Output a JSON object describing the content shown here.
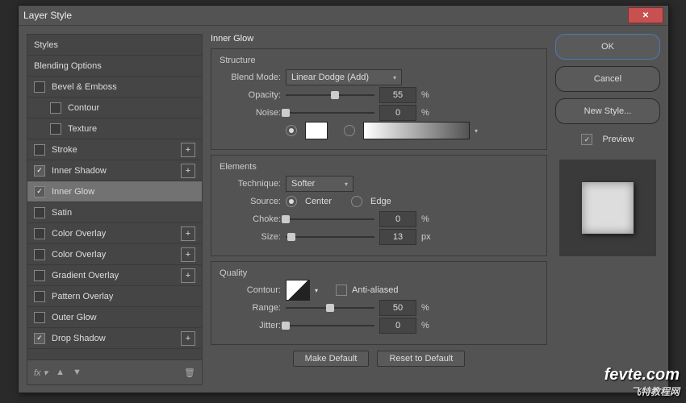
{
  "title": "Layer Style",
  "styles": {
    "header1": "Styles",
    "header2": "Blending Options",
    "items": [
      {
        "label": "Bevel & Emboss",
        "checked": false,
        "plus": false,
        "indent": false
      },
      {
        "label": "Contour",
        "checked": false,
        "plus": false,
        "indent": true
      },
      {
        "label": "Texture",
        "checked": false,
        "plus": false,
        "indent": true
      },
      {
        "label": "Stroke",
        "checked": false,
        "plus": true,
        "indent": false
      },
      {
        "label": "Inner Shadow",
        "checked": true,
        "plus": true,
        "indent": false
      },
      {
        "label": "Inner Glow",
        "checked": true,
        "plus": false,
        "indent": false,
        "selected": true
      },
      {
        "label": "Satin",
        "checked": false,
        "plus": false,
        "indent": false
      },
      {
        "label": "Color Overlay",
        "checked": false,
        "plus": true,
        "indent": false
      },
      {
        "label": "Color Overlay",
        "checked": false,
        "plus": true,
        "indent": false
      },
      {
        "label": "Gradient Overlay",
        "checked": false,
        "plus": true,
        "indent": false
      },
      {
        "label": "Pattern Overlay",
        "checked": false,
        "plus": false,
        "indent": false
      },
      {
        "label": "Outer Glow",
        "checked": false,
        "plus": false,
        "indent": false
      },
      {
        "label": "Drop Shadow",
        "checked": true,
        "plus": true,
        "indent": false
      }
    ]
  },
  "panel": {
    "title": "Inner Glow",
    "structure_label": "Structure",
    "blend_mode_label": "Blend Mode:",
    "blend_mode_value": "Linear Dodge (Add)",
    "opacity_label": "Opacity:",
    "opacity_value": "55",
    "noise_label": "Noise:",
    "noise_value": "0",
    "percent": "%",
    "elements_label": "Elements",
    "technique_label": "Technique:",
    "technique_value": "Softer",
    "source_label": "Source:",
    "source_center": "Center",
    "source_edge": "Edge",
    "choke_label": "Choke:",
    "choke_value": "0",
    "size_label": "Size:",
    "size_value": "13",
    "px": "px",
    "quality_label": "Quality",
    "contour_label": "Contour:",
    "anti_aliased": "Anti-aliased",
    "range_label": "Range:",
    "range_value": "50",
    "jitter_label": "Jitter:",
    "jitter_value": "0",
    "make_default": "Make Default",
    "reset_default": "Reset to Default"
  },
  "right": {
    "ok": "OK",
    "cancel": "Cancel",
    "new_style": "New Style...",
    "preview": "Preview"
  },
  "watermark": {
    "main": "fevte.com",
    "sub": "飞特教程网"
  }
}
